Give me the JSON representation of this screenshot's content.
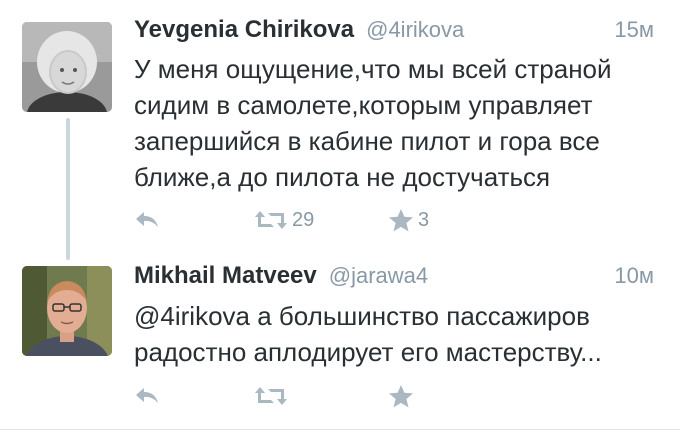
{
  "colors": {
    "text": "#292f33",
    "secondary": "#8899a6",
    "icon": "#aab8c2",
    "thread_line": "#ccd6dd"
  },
  "tweets": [
    {
      "name": "Yevgenia Chirikova",
      "handle": "@4irikova",
      "time": "15м",
      "lines": [
        "У меня ощущение,что мы всей страной",
        "сидим в самолете,которым управляет",
        "запершийся в кабине пилот и гора все",
        "ближе,а до пилота не достучаться"
      ],
      "retweets": "29",
      "favorites": "3",
      "icons": [
        "reply-icon",
        "retweet-icon",
        "favorite-star-icon"
      ]
    },
    {
      "name": "Mikhail Matveev",
      "handle": "@jarawa4",
      "time": "10м",
      "lines": [
        "@4irikova а большинство пассажиров",
        "радостно аплодирует его мастерству..."
      ],
      "retweets": "",
      "favorites": "",
      "icons": [
        "reply-icon",
        "retweet-icon",
        "favorite-star-icon"
      ]
    }
  ]
}
